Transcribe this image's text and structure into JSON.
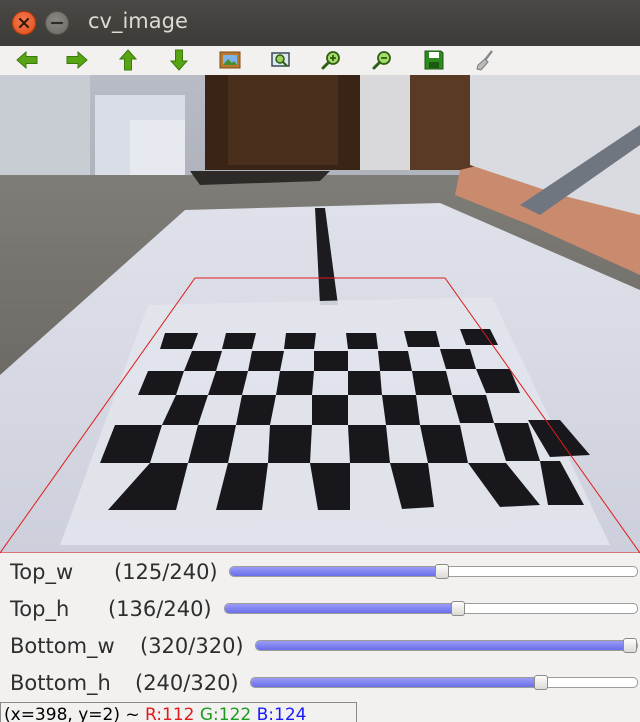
{
  "window": {
    "title": "cv_image",
    "close_icon": "close-icon",
    "minimize_icon": "minimize-icon"
  },
  "toolbar": {
    "buttons": [
      {
        "name": "pan-left-button",
        "icon": "arrow-left-icon"
      },
      {
        "name": "pan-right-button",
        "icon": "arrow-right-icon"
      },
      {
        "name": "pan-up-button",
        "icon": "arrow-up-icon"
      },
      {
        "name": "pan-down-button",
        "icon": "arrow-down-icon"
      },
      {
        "name": "zoom-fit-button",
        "icon": "picture-icon"
      },
      {
        "name": "zoom-region-button",
        "icon": "zoom-region-icon"
      },
      {
        "name": "zoom-in-button",
        "icon": "zoom-in-icon"
      },
      {
        "name": "zoom-out-button",
        "icon": "zoom-out-icon"
      },
      {
        "name": "save-button",
        "icon": "save-icon"
      },
      {
        "name": "properties-button",
        "icon": "brush-icon"
      }
    ]
  },
  "image": {
    "description_icon": "camera-image",
    "roi_color": "#e01b1b"
  },
  "trackbars": [
    {
      "label": "Top_w",
      "value_text": "(125/240)",
      "value": 125,
      "max": 240
    },
    {
      "label": "Top_h",
      "value_text": "(136/240)",
      "value": 136,
      "max": 240
    },
    {
      "label": "Bottom_w",
      "value_text": "(320/320)",
      "value": 320,
      "max": 320
    },
    {
      "label": "Bottom_h",
      "value_text": "(240/320)",
      "value": 240,
      "max": 320
    }
  ],
  "status": {
    "coords": "(x=398, y=2) ~ ",
    "r": "R:112",
    "g": " G:122",
    "b": " B:124",
    "r_color": "#e01b1b",
    "g_color": "#1e9a1e",
    "b_color": "#1a1aff"
  }
}
